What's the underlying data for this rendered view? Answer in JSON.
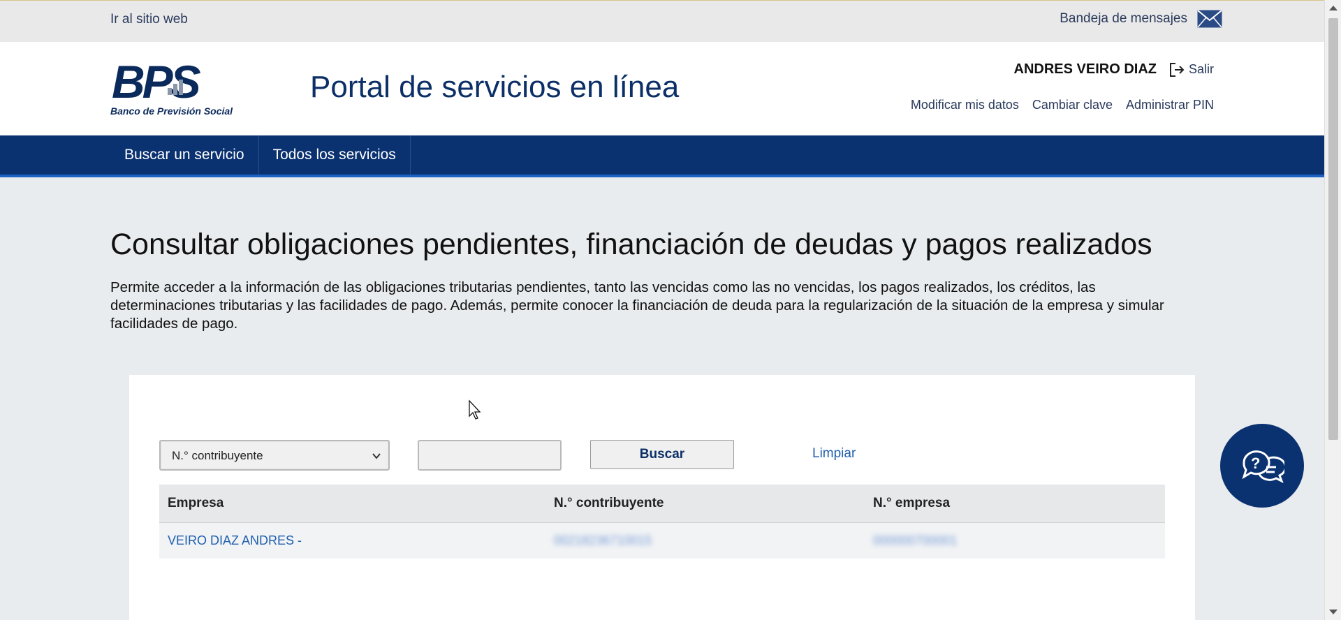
{
  "topbar": {
    "site_link": "Ir al sitio web",
    "inbox_label": "Bandeja de mensajes",
    "inbox_icon": "envelope-icon"
  },
  "header": {
    "logo_text": "BPS",
    "logo_subtitle": "Banco de Previsión Social",
    "portal_title": "Portal de servicios en línea",
    "user_name": "ANDRES VEIRO DIAZ",
    "logout_label": "Salir",
    "account_links": [
      "Modificar mis datos",
      "Cambiar clave",
      "Administrar PIN"
    ]
  },
  "nav": {
    "items": [
      "Buscar un servicio",
      "Todos los servicios"
    ]
  },
  "main": {
    "title": "Consultar obligaciones pendientes, financiación de deudas y pagos realizados",
    "description": "Permite acceder a la información de las obligaciones tributarias pendientes, tanto las vencidas como las no vencidas, los pagos realizados, los créditos, las determinaciones tributarias y las facilidades de pago. Además, permite conocer la financiación de deuda para la regularización de la situación de la empresa y simular facilidades de pago."
  },
  "search": {
    "select_value": "N.° contribuyente",
    "input_value": "",
    "search_button": "Buscar",
    "clear_link": "Limpiar"
  },
  "table": {
    "headers": [
      "Empresa",
      "N.° contribuyente",
      "N.° empresa"
    ],
    "rows": [
      {
        "company": "VEIRO DIAZ ANDRES -",
        "contributor": "00218236710015",
        "enterprise": "000000700001"
      }
    ]
  },
  "colors": {
    "brand_navy": "#0a3170",
    "link_blue": "#1f5fad",
    "nav_accent": "#1b62c4"
  }
}
